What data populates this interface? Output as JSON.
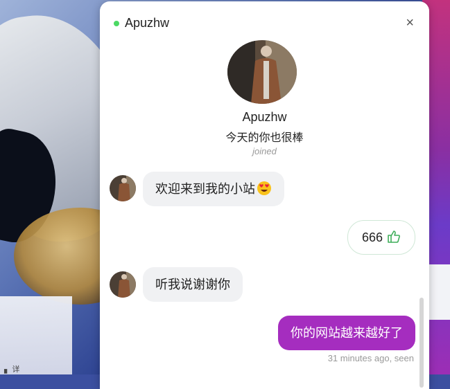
{
  "chat": {
    "title": "Apuzhw",
    "status_color": "#4cd964",
    "close_label": "×",
    "profile": {
      "name": "Apuzhw",
      "bio": "今天的你也很棒",
      "joined": "joined"
    },
    "messages": [
      {
        "from": "them",
        "text": "欢迎来到我的小站",
        "emoji": "heart-eyes-emoji"
      },
      {
        "from": "me",
        "text": "666",
        "emoji": "thumbs-up-icon"
      },
      {
        "from": "them",
        "text": "听我说谢谢你"
      },
      {
        "from": "me",
        "text": "你的网站越来越好了"
      }
    ],
    "last_meta": "31 minutes ago, seen"
  },
  "colors": {
    "accent_purple": "#a52dbf",
    "bubble_in": "#f0f1f3",
    "online": "#4cd964"
  },
  "background": {
    "bottom_text": "▖ 详"
  }
}
